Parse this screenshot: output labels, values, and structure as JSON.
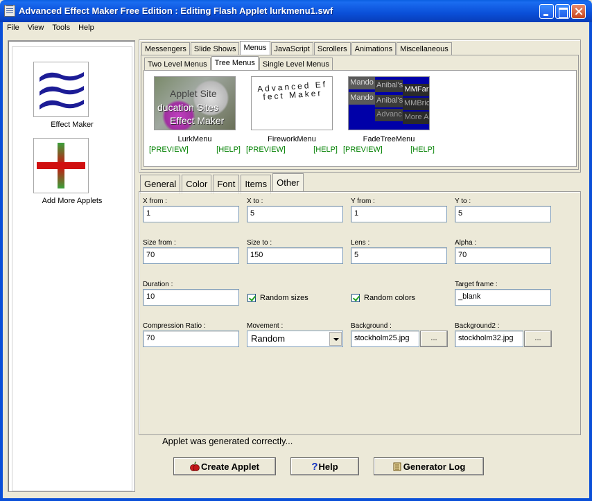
{
  "window": {
    "title": "Advanced Effect Maker Free Edition : Editing Flash Applet lurkmenu1.swf"
  },
  "menu": {
    "items": [
      "File",
      "View",
      "Tools",
      "Help"
    ]
  },
  "left_panel": {
    "tools": [
      {
        "label": "Effect Maker",
        "icon": "waves-icon"
      },
      {
        "label": "Add More Applets",
        "icon": "red-cross-icon"
      }
    ]
  },
  "applet_categories": {
    "tabs": [
      "Messengers",
      "Slide Shows",
      "Menus",
      "JavaScript",
      "Scrollers",
      "Animations",
      "Miscellaneous"
    ],
    "active": "Menus",
    "subtabs": [
      "Two Level Menus",
      "Tree Menus",
      "Single Level Menus"
    ],
    "active_subtab": "Tree Menus"
  },
  "applets": [
    {
      "name": "LurkMenu",
      "preview": "[PREVIEW]",
      "help": "[HELP]",
      "thumb_text": [
        "Applet Site",
        "ducation Sites",
        "Effect Maker"
      ]
    },
    {
      "name": "FireworkMenu",
      "preview": "[PREVIEW]",
      "help": "[HELP]",
      "thumb_text": "Advanced Effect Maker"
    },
    {
      "name": "FadeTreeMenu",
      "preview": "[PREVIEW]",
      "help": "[HELP]",
      "thumb_text": [
        "Mando",
        "Anibal's",
        "MMFar",
        "Mando",
        "Anibal's",
        "MMBric",
        "Advanc",
        "More A"
      ]
    }
  ],
  "property_tabs": {
    "tabs": [
      "General",
      "Color",
      "Font",
      "Items",
      "Other"
    ],
    "active": "Other"
  },
  "fields": {
    "x_from": {
      "label": "X from :",
      "value": "1"
    },
    "x_to": {
      "label": "X to :",
      "value": "5"
    },
    "y_from": {
      "label": "Y from :",
      "value": "1"
    },
    "y_to": {
      "label": "Y to :",
      "value": "5"
    },
    "size_from": {
      "label": "Size from :",
      "value": "70"
    },
    "size_to": {
      "label": "Size to :",
      "value": "150"
    },
    "lens": {
      "label": "Lens :",
      "value": "5"
    },
    "alpha": {
      "label": "Alpha :",
      "value": "70"
    },
    "duration": {
      "label": "Duration :",
      "value": "10"
    },
    "random_sizes": {
      "label": "Random sizes",
      "checked": true
    },
    "random_colors": {
      "label": "Random colors",
      "checked": true
    },
    "target_frame": {
      "label": "Target frame :",
      "value": "_blank"
    },
    "compression_ratio": {
      "label": "Compression Ratio :",
      "value": "70"
    },
    "movement": {
      "label": "Movement :",
      "value": "Random"
    },
    "background": {
      "label": "Background :",
      "value": "stockholm25.jpg",
      "browse": "..."
    },
    "background2": {
      "label": "Background2 :",
      "value": "stockholm32.jpg",
      "browse": "..."
    }
  },
  "status": "Applet was generated correctly...",
  "buttons": {
    "create": "Create Applet",
    "help": "Help",
    "log": "Generator Log"
  }
}
